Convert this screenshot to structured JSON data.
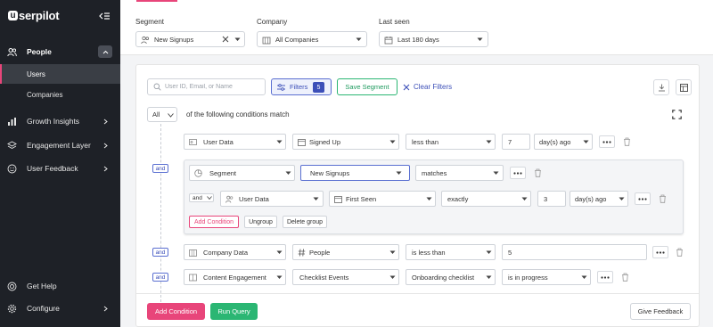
{
  "app": {
    "logo": "userpilot",
    "logo_letter": "u",
    "logo_rest": "serpilot"
  },
  "sidebar": {
    "people": "People",
    "sub_items": [
      "Users",
      "Companies"
    ],
    "items": [
      "Growth Insights",
      "Engagement Layer",
      "User Feedback"
    ],
    "bottom": [
      "Get Help",
      "Configure"
    ]
  },
  "header": {
    "segment": {
      "label": "Segment",
      "value": "New Signups"
    },
    "company": {
      "label": "Company",
      "value": "All Companies"
    },
    "last_seen": {
      "label": "Last seen",
      "value": "Last 180 days"
    }
  },
  "toolbar": {
    "search_placeholder": "User ID, Email, or Name",
    "filters_label": "Filters",
    "filters_count": "5",
    "save_segment": "Save Segment",
    "clear_filters": "Clear Filters"
  },
  "conditions": {
    "match_mode": "All",
    "match_text": "of the following conditions match",
    "and_label": "and",
    "rows": [
      {
        "category": "User Data",
        "field": "Signed Up",
        "operator": "less than",
        "value": "7",
        "unit": "day(s) ago"
      },
      {
        "category": "Company Data",
        "field": "People",
        "operator": "is less than",
        "value": "5"
      },
      {
        "category": "Content Engagement",
        "field": "Checklist Events",
        "operator": "Onboarding checklist",
        "value": "is in progress"
      }
    ],
    "group": {
      "rows": [
        {
          "category": "Segment",
          "field": "New Signups",
          "operator": "matches"
        },
        {
          "category": "User Data",
          "field": "First Seen",
          "operator": "exactly",
          "value": "3",
          "unit": "day(s) ago"
        }
      ],
      "add_condition": "Add Condition",
      "ungroup": "Ungroup",
      "delete_group": "Delete group"
    }
  },
  "footer": {
    "add_condition": "Add Condition",
    "run_query": "Run Query",
    "give_feedback": "Give Feedback"
  },
  "colors": {
    "accent_pink": "#e8457a",
    "accent_green": "#2bb673",
    "accent_blue": "#3c4fb8",
    "sidebar_bg": "#1e2127"
  }
}
